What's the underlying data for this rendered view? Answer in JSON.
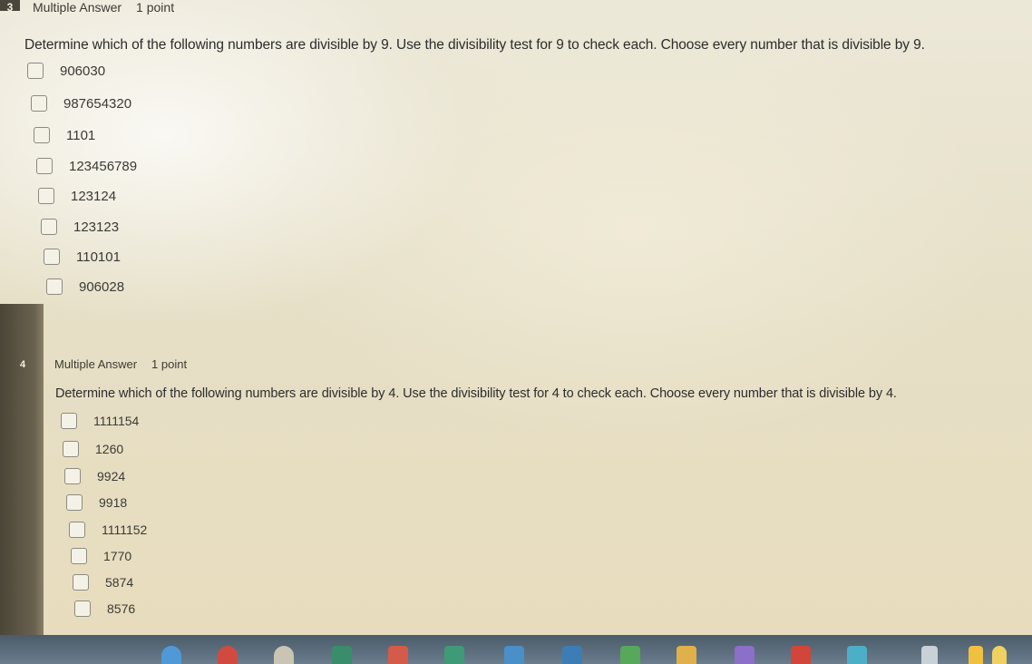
{
  "questions": [
    {
      "number": "3",
      "type": "Multiple Answer",
      "points": "1 point",
      "prompt": "Determine which of the following numbers are divisible by 9.  Use the divisibility test for 9 to check each.  Choose every number that is divisible by 9.",
      "options": [
        "906030",
        "987654320",
        "1101",
        "123456789",
        "123124",
        "123123",
        "110101",
        "906028"
      ]
    },
    {
      "number": "4",
      "type": "Multiple Answer",
      "points": "1 point",
      "prompt": "Determine which of the following numbers are divisible by 4.  Use the divisibility test for 4 to check each.  Choose every number that is divisible by 4.",
      "options": [
        "1111154",
        "1260",
        "9924",
        "9918",
        "1111152",
        "1770",
        "5874",
        "8576"
      ]
    }
  ],
  "taskbar": {
    "icons": [
      "chrome-icon",
      "gmail-icon",
      "docs-icon",
      "drive-icon",
      "slides-icon",
      "classroom-icon",
      "youtube-icon",
      "play-store-icon",
      "files-icon"
    ]
  },
  "colors": {
    "page_bg": "#e9e3cf",
    "text": "#2c2c2c",
    "taskbar": "#5b6c7b"
  }
}
